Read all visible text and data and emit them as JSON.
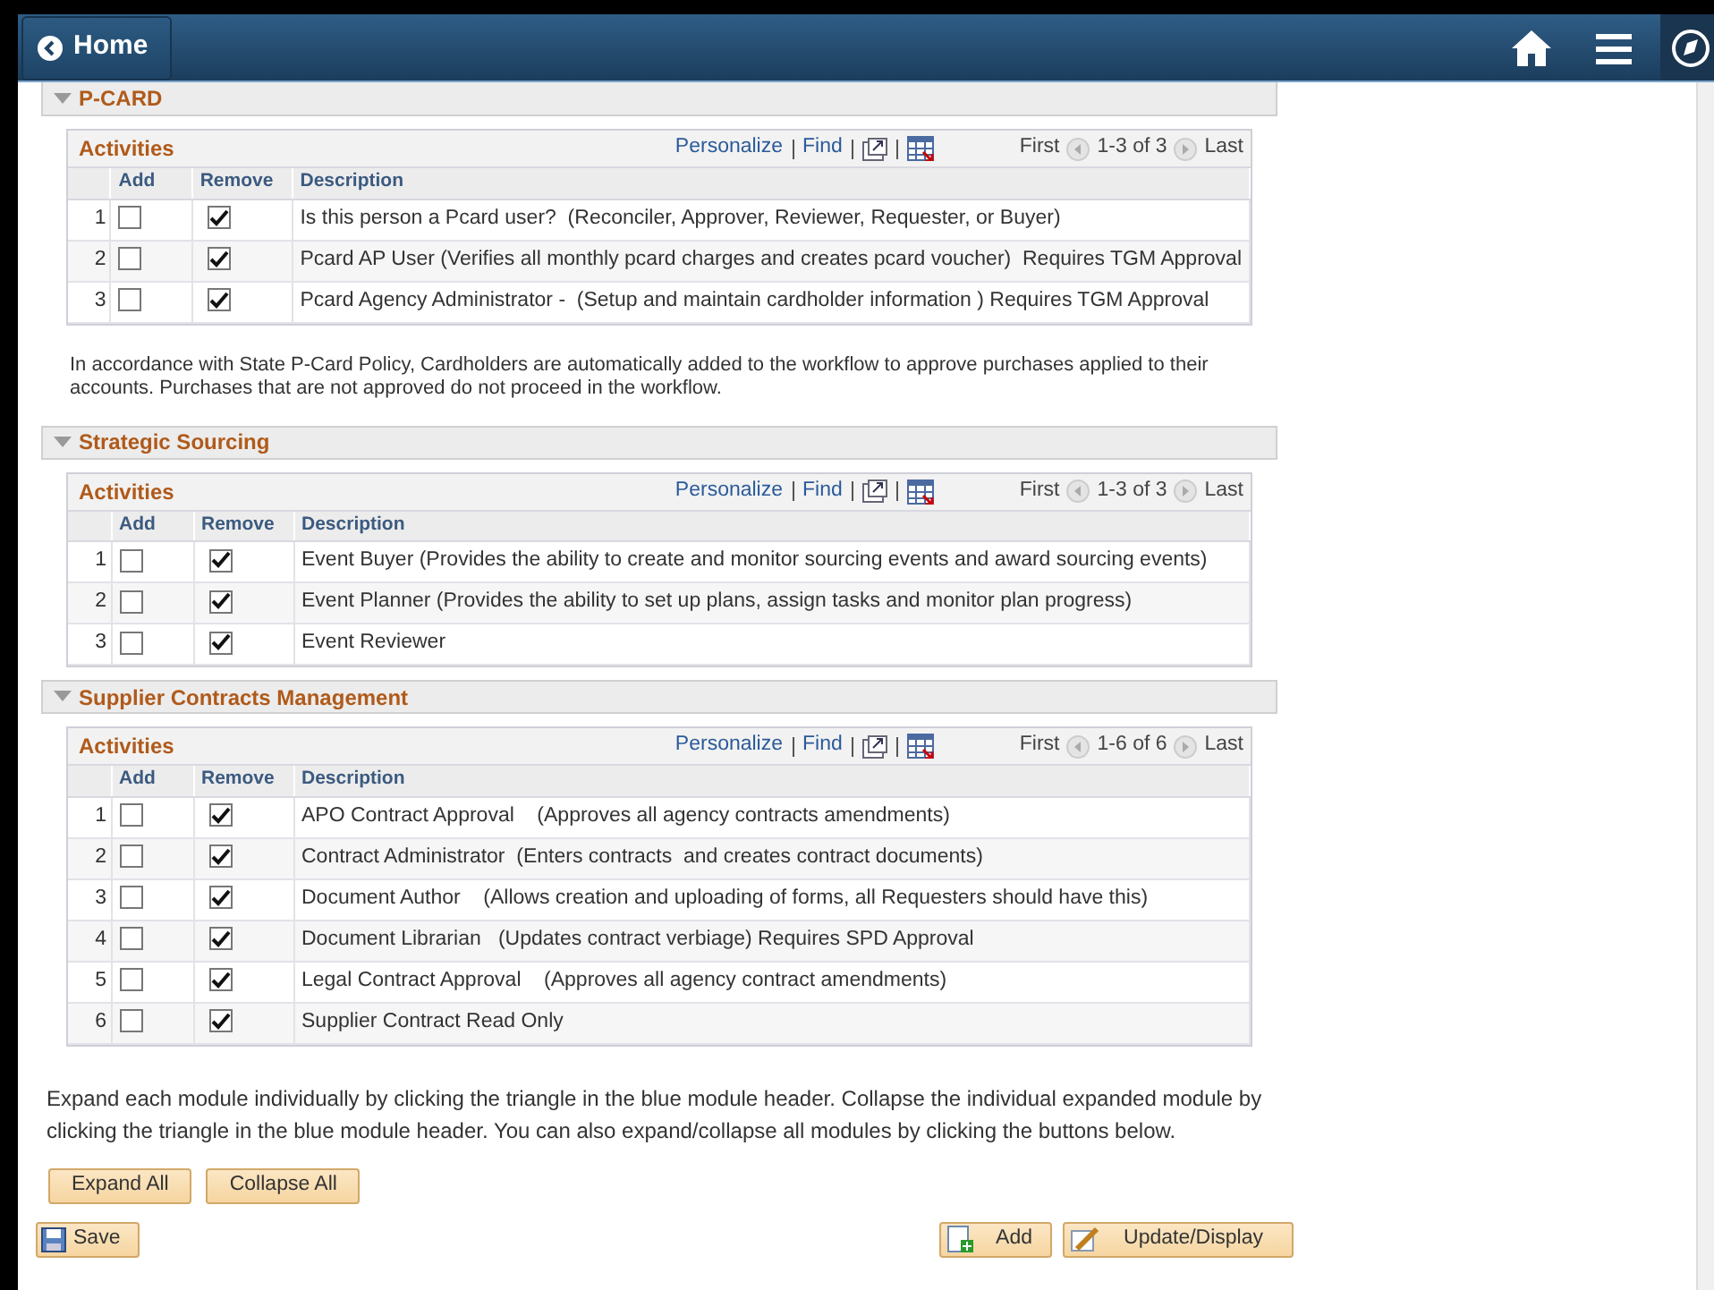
{
  "header": {
    "back_label": "Home"
  },
  "sections": [
    {
      "title": "P-CARD",
      "expanded": true,
      "grid": {
        "title": "Activities",
        "links": [
          "Personalize",
          "Find"
        ],
        "first": "First",
        "range": "1-3 of 3",
        "last": "Last",
        "columns": [
          "Add",
          "Remove",
          "Description"
        ],
        "rows": [
          {
            "number": "1",
            "add": false,
            "remove": true,
            "description": "Is this person a Pcard user?  (Reconciler, Approver, Reviewer, Requester, or Buyer)"
          },
          {
            "number": "2",
            "add": false,
            "remove": true,
            "description": "Pcard AP User (Verifies all monthly pcard charges and creates pcard voucher)  Requires TGM Approval"
          },
          {
            "number": "3",
            "add": false,
            "remove": true,
            "description": "Pcard Agency Administrator -  (Setup and maintain cardholder information ) Requires TGM Approval"
          }
        ]
      },
      "note": "In accordance with State P-Card Policy, Cardholders are automatically added to the workflow to approve purchases applied to their accounts. Purchases that are not approved do not proceed in the workflow."
    },
    {
      "title": "Strategic Sourcing",
      "expanded": true,
      "grid": {
        "title": "Activities",
        "links": [
          "Personalize",
          "Find"
        ],
        "first": "First",
        "range": "1-3 of 3",
        "last": "Last",
        "columns": [
          "Add",
          "Remove",
          "Description"
        ],
        "rows": [
          {
            "number": "1",
            "add": false,
            "remove": true,
            "description": "Event Buyer (Provides the ability to create and monitor sourcing events and award sourcing events)"
          },
          {
            "number": "2",
            "add": false,
            "remove": true,
            "description": "Event Planner (Provides the ability to set up plans, assign tasks and monitor plan progress)"
          },
          {
            "number": "3",
            "add": false,
            "remove": true,
            "description": "Event Reviewer"
          }
        ]
      }
    },
    {
      "title": "Supplier Contracts Management",
      "expanded": true,
      "grid": {
        "title": "Activities",
        "links": [
          "Personalize",
          "Find"
        ],
        "first": "First",
        "range": "1-6 of 6",
        "last": "Last",
        "columns": [
          "Add",
          "Remove",
          "Description"
        ],
        "rows": [
          {
            "number": "1",
            "add": false,
            "remove": true,
            "description": "APO Contract Approval    (Approves all agency contracts amendments)"
          },
          {
            "number": "2",
            "add": false,
            "remove": true,
            "description": "Contract Administrator  (Enters contracts  and creates contract documents)"
          },
          {
            "number": "3",
            "add": false,
            "remove": true,
            "description": "Document Author    (Allows creation and uploading of forms, all Requesters should have this)"
          },
          {
            "number": "4",
            "add": false,
            "remove": true,
            "description": "Document Librarian   (Updates contract verbiage) Requires SPD Approval"
          },
          {
            "number": "5",
            "add": false,
            "remove": true,
            "description": "Legal Contract Approval    (Approves all agency contract amendments)"
          },
          {
            "number": "6",
            "add": false,
            "remove": true,
            "description": "Supplier Contract Read Only"
          }
        ]
      }
    }
  ],
  "instructions": "Expand each module individually by clicking the triangle in the blue module header. Collapse the individual expanded module by clicking the triangle in the blue module header. You can also expand/collapse all modules by clicking the buttons below.",
  "expand_buttons": [
    "Expand All",
    "Collapse All"
  ],
  "save_button": "Save",
  "action_buttons": [
    {
      "kind": "add",
      "label": "Add"
    },
    {
      "kind": "update",
      "label": "Update/Display"
    }
  ]
}
